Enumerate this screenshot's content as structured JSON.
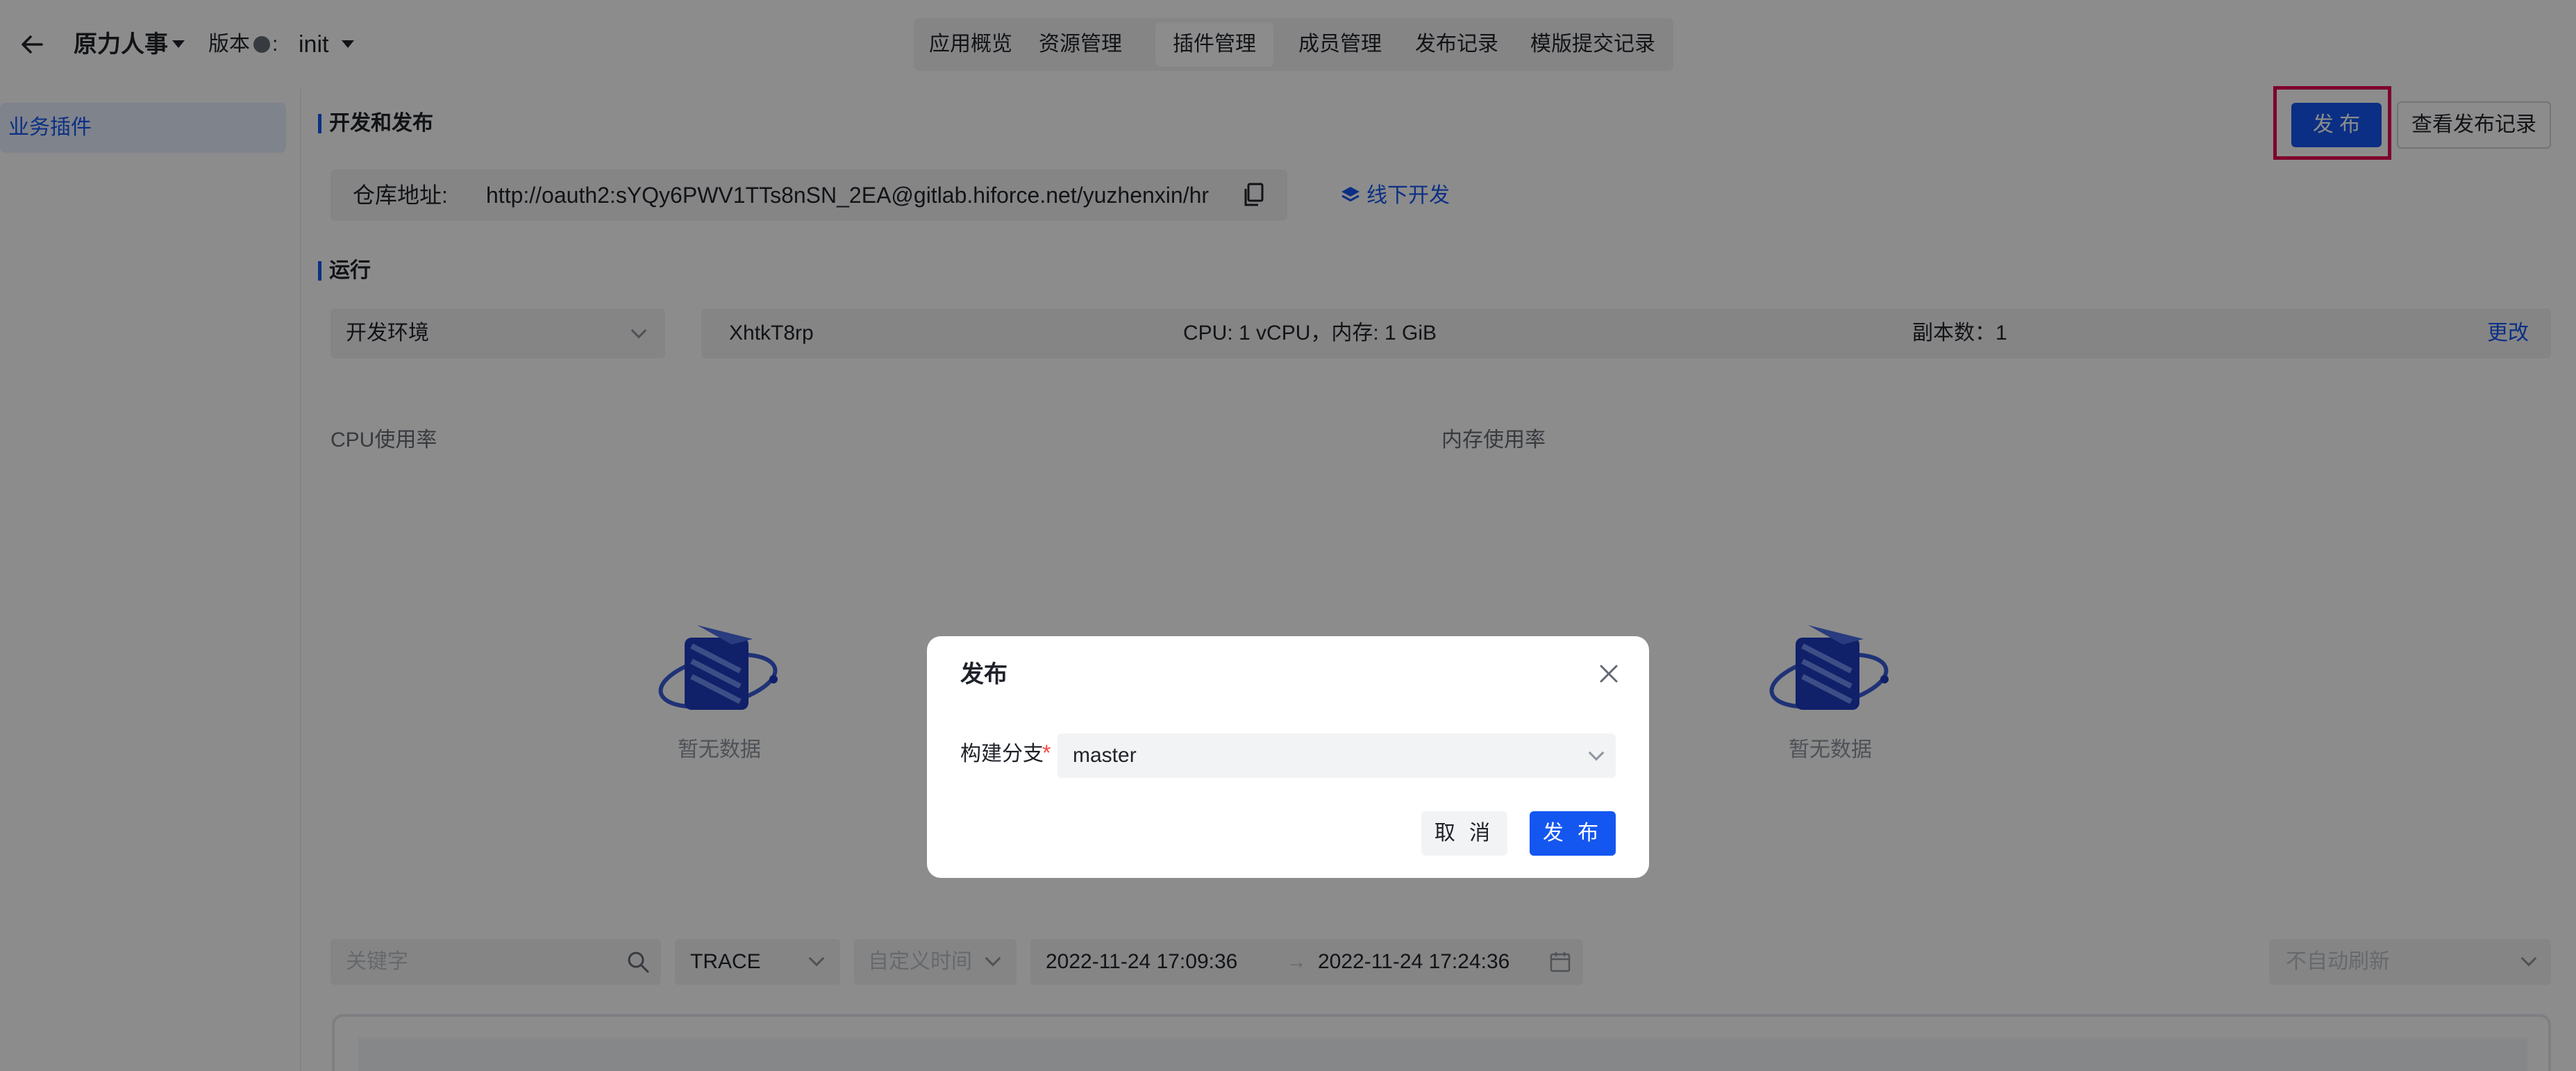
{
  "topbar": {
    "app_name": "原力人事",
    "version_label": "版本",
    "version_colon": ":",
    "version_value": "init"
  },
  "nav": {
    "tabs": [
      {
        "label": "应用概览",
        "active": false
      },
      {
        "label": "资源管理",
        "active": false
      },
      {
        "label": "插件管理",
        "active": true
      },
      {
        "label": "成员管理",
        "active": false
      },
      {
        "label": "发布记录",
        "active": false
      },
      {
        "label": "模版提交记录",
        "active": false
      }
    ]
  },
  "sidebar": {
    "items": [
      {
        "label": "业务插件",
        "active": true
      }
    ]
  },
  "dev_section": {
    "title": "开发和发布",
    "publish_button": "发 布",
    "view_records_button": "查看发布记录",
    "repo_label": "仓库地址:",
    "repo_url": "http://oauth2:sYQy6PWV1TTs8nSN_2EA@gitlab.hiforce.net/yuzhenxin/hr",
    "offline_dev": "线下开发"
  },
  "run_section": {
    "title": "运行",
    "env_value": "开发环境",
    "instance_id": "XhtkT8rp",
    "resources": "CPU: 1 vCPU，内存: 1 GiB",
    "replicas": "副本数：1",
    "change_link": "更改"
  },
  "charts": {
    "cpu_title": "CPU使用率",
    "mem_title": "内存使用率",
    "empty_text": "暂无数据"
  },
  "filters": {
    "keyword_placeholder": "关键字",
    "level_value": "TRACE",
    "time_mode_placeholder": "自定义时间",
    "start_time": "2022-11-24 17:09:36",
    "arrow": "→",
    "end_time": "2022-11-24 17:24:36",
    "refresh_placeholder": "不自动刷新"
  },
  "modal": {
    "title": "发布",
    "branch_label": "构建分支",
    "required_mark": "*",
    "branch_value": "master",
    "cancel_button": "取 消",
    "submit_button": "发 布"
  },
  "colors": {
    "primary": "#1456f0",
    "highlight": "#e5004f",
    "overlay": "rgba(0,0,0,0.45)"
  }
}
